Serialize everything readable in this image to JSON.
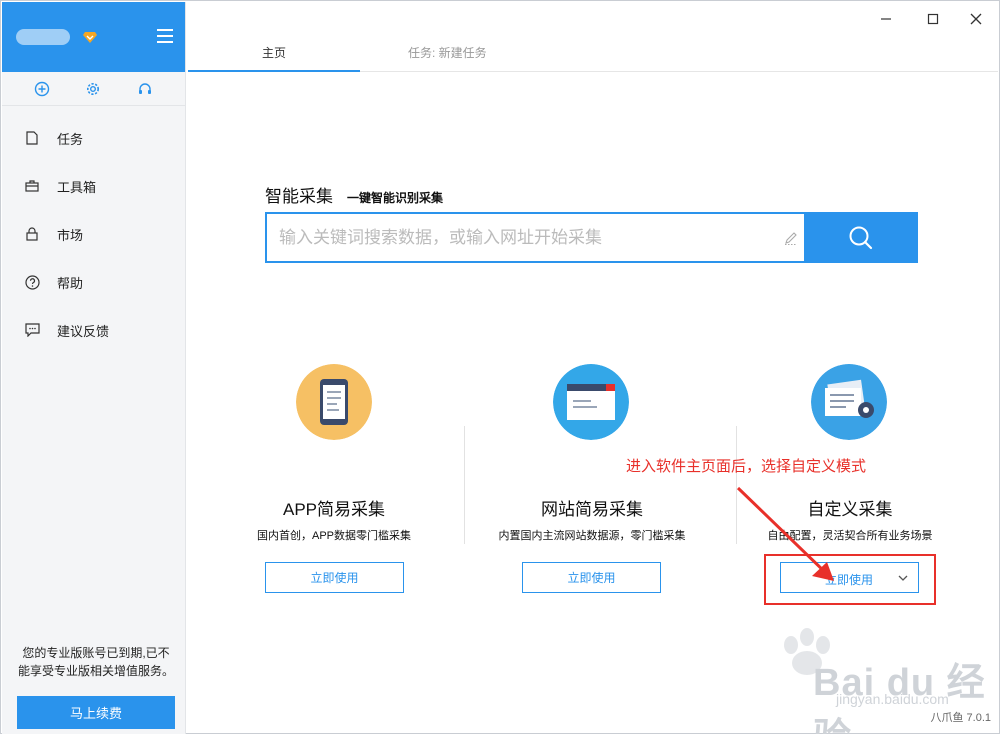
{
  "sidebar": {
    "nav": [
      {
        "label": "任务",
        "icon": "document-icon"
      },
      {
        "label": "工具箱",
        "icon": "toolbox-icon"
      },
      {
        "label": "市场",
        "icon": "lock-icon"
      },
      {
        "label": "帮助",
        "icon": "question-icon"
      },
      {
        "label": "建议反馈",
        "icon": "feedback-icon"
      }
    ],
    "expired_text": "您的专业版账号已到期,已不能享受专业版相关增值服务。",
    "renew_label": "马上续费"
  },
  "tabs": {
    "home": "主页",
    "task": "任务: 新建任务"
  },
  "smart": {
    "title": "智能采集",
    "subtitle": "一键智能识别采集",
    "placeholder": "输入关键词搜索数据，或输入网址开始采集"
  },
  "cards": [
    {
      "title": "APP简易采集",
      "desc": "国内首创，APP数据零门槛采集",
      "button": "立即使用"
    },
    {
      "title": "网站简易采集",
      "desc": "内置国内主流网站数据源，零门槛采集",
      "button": "立即使用"
    },
    {
      "title": "自定义采集",
      "desc": "自由配置，灵活契合所有业务场景",
      "button": "立即使用"
    }
  ],
  "annotation": "进入软件主页面后，选择自定义模式",
  "watermark": {
    "text": "Bai du 经验",
    "url": "jingyan.baidu.com"
  },
  "version": "八爪鱼 7.0.1",
  "colors": {
    "accent": "#2a93ec",
    "annotation": "#e8302a"
  }
}
